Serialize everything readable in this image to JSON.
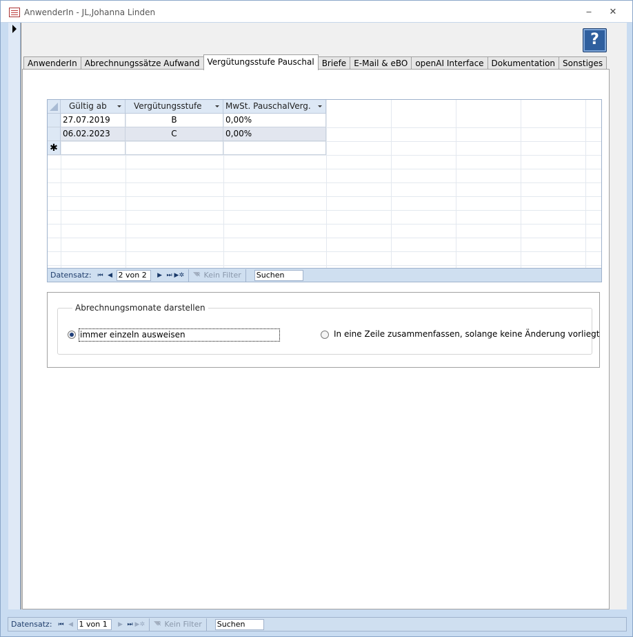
{
  "window": {
    "title": "AnwenderIn - JL,Johanna Linden",
    "minimize_glyph": "‒",
    "close_glyph": "✕"
  },
  "help_button": {
    "label": "?"
  },
  "tabs": [
    {
      "label": "AnwenderIn",
      "active": false
    },
    {
      "label": "Abrechnungssätze Aufwand",
      "active": false
    },
    {
      "label": "Vergütungsstufe Pauschal",
      "active": true
    },
    {
      "label": "Briefe",
      "active": false
    },
    {
      "label": "E-Mail & eBO",
      "active": false
    },
    {
      "label": "openAI Interface",
      "active": false
    },
    {
      "label": "Dokumentation",
      "active": false
    },
    {
      "label": "Sonstiges",
      "active": false
    }
  ],
  "datasheet": {
    "columns": [
      "Gültig ab",
      "Vergütungsstufe",
      "MwSt. PauschalVerg."
    ],
    "rows": [
      [
        "27.07.2019",
        "B",
        "0,00%"
      ],
      [
        "06.02.2023",
        "C",
        "0,00%"
      ]
    ],
    "new_row_marker": "✱"
  },
  "subform_nav": {
    "label": "Datensatz:",
    "position": "2 von 2",
    "filter": "Kein Filter",
    "search": "Suchen"
  },
  "option_group": {
    "title": "Abrechnungsmonate darstellen",
    "option1": "immer einzeln ausweisen",
    "option2": "In eine Zeile zusammenfassen, solange keine Änderung vorliegt",
    "selected": "option1"
  },
  "form_nav": {
    "label": "Datensatz:",
    "position": "1 von 1",
    "filter": "Kein Filter",
    "search": "Suchen"
  },
  "colors": {
    "nav_bar": "#cfdff0",
    "header": "#dde8f5",
    "help_button": "#2f5f9e"
  }
}
